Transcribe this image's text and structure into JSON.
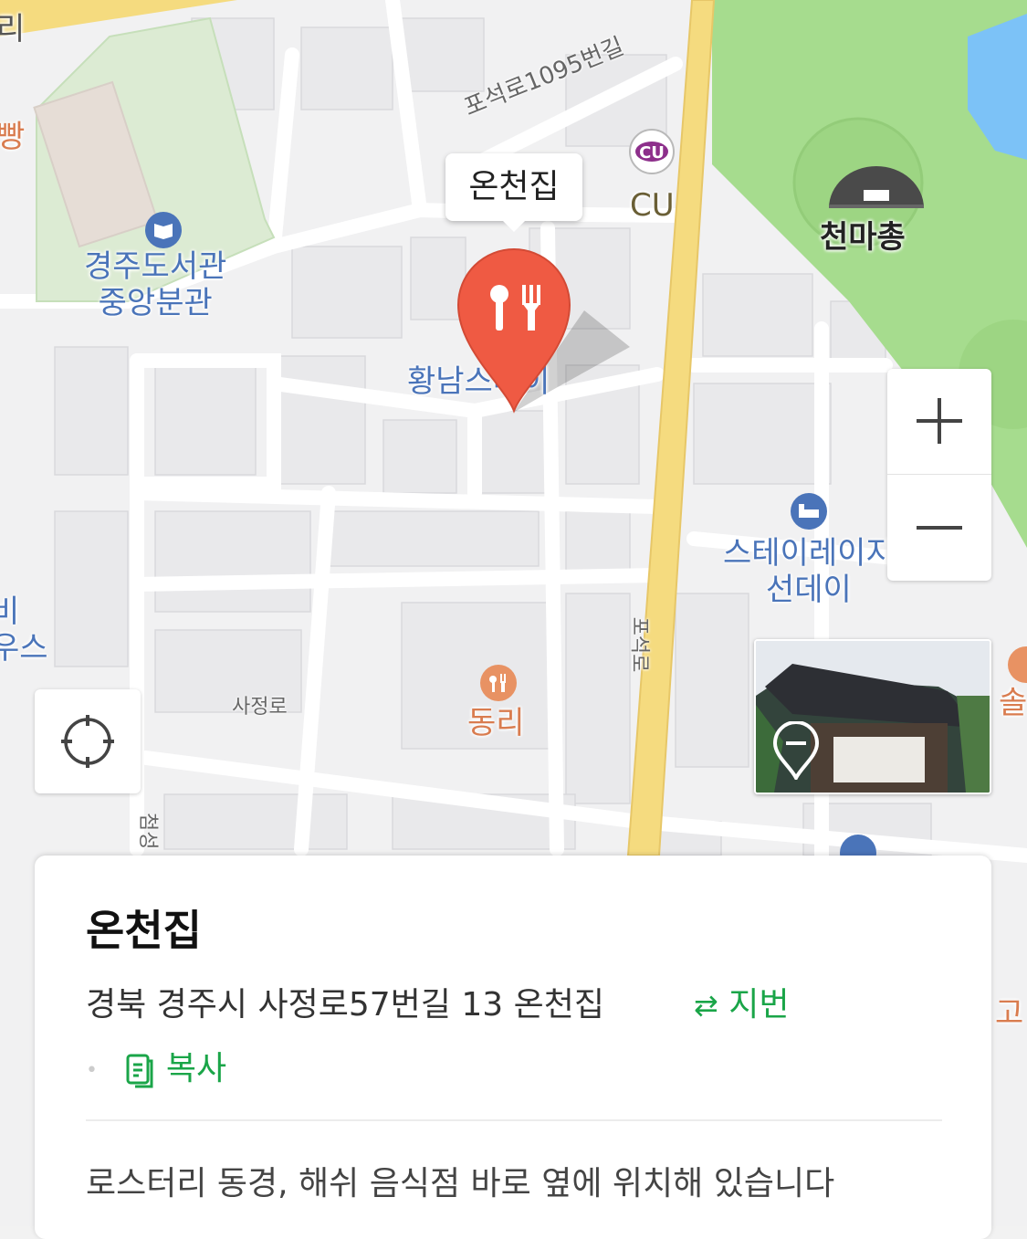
{
  "map": {
    "labels": {
      "library": "경주도서관\n중앙분관",
      "hwangnam": "황남스테이",
      "cheonmachong": "천마총",
      "cu_store": "CU",
      "stay": "스테이레이지\n선데이",
      "dongri": "동리",
      "edge_top_left": "리",
      "edge_bakery": "빵",
      "edge_left": "비\n우스",
      "edge_right": "솔",
      "edge_right2": "고"
    },
    "roads": {
      "poseok_1095": "포석로1095번길",
      "poseok": "포석로",
      "sajeong": "사정로",
      "cheomseong": "첨성"
    },
    "cu_logo": "CU",
    "selected_callout": "온천집",
    "selected_pin_icon": "restaurant-pin-icon",
    "zoom_in_icon": "plus-icon",
    "zoom_out_icon": "minus-icon",
    "locate_icon": "crosshair-icon",
    "colors": {
      "pin": "#ef5a43",
      "poi_blue": "#4a74b9",
      "poi_orange": "#e89263",
      "park": "#a6dc8e",
      "water": "#7cc2f7",
      "major_road": "#f5db7f",
      "accent_green": "#1aa548"
    }
  },
  "place": {
    "name": "온천집",
    "address": "경북 경주시 사정로57번길 13 온천집",
    "jibun_label": "지번",
    "copy_label": "복사",
    "description": "로스터리 동경, 해쉬 음식점 바로 옆에 위치해 있습니다"
  }
}
